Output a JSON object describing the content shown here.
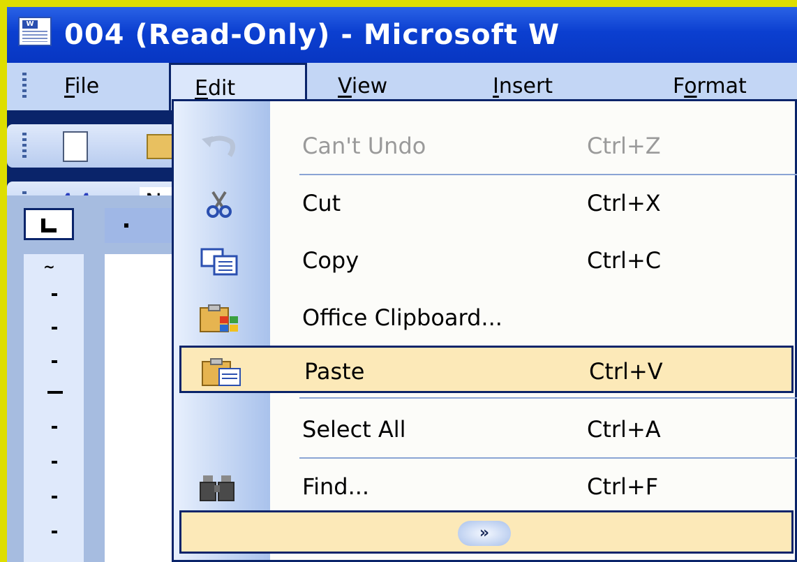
{
  "window": {
    "title": "004 (Read-Only) - Microsoft W"
  },
  "menubar": {
    "items": [
      {
        "label": "File",
        "accel": "F"
      },
      {
        "label": "Edit",
        "accel": "E",
        "active": true
      },
      {
        "label": "View",
        "accel": "V"
      },
      {
        "label": "Insert",
        "accel": "I"
      },
      {
        "label": "Format",
        "accel": "o"
      }
    ]
  },
  "format_toolbar": {
    "font_partial": "N"
  },
  "edit_menu": {
    "items": [
      {
        "label": "Can't Undo",
        "shortcut": "Ctrl+Z",
        "icon": "undo-icon",
        "enabled": false
      },
      {
        "label": "Cut",
        "shortcut": "Ctrl+X",
        "icon": "scissors-icon",
        "enabled": true
      },
      {
        "label": "Copy",
        "shortcut": "Ctrl+C",
        "icon": "copy-icon",
        "enabled": true
      },
      {
        "label": "Office Clipboard...",
        "shortcut": "",
        "icon": "clipboard-icon",
        "enabled": true
      },
      {
        "label": "Paste",
        "shortcut": "Ctrl+V",
        "icon": "paste-icon",
        "enabled": true,
        "highlighted": true
      },
      {
        "label": "Select All",
        "shortcut": "Ctrl+A",
        "icon": "",
        "enabled": true
      },
      {
        "label": "Find...",
        "shortcut": "Ctrl+F",
        "icon": "binoculars-icon",
        "enabled": true
      }
    ],
    "expand_glyph": "»"
  },
  "colors": {
    "titlebar": "#0b3fd0",
    "menubar": "#c3d6f5",
    "highlight": "#fce9b8",
    "border": "#0a246a",
    "background": "#dede00"
  }
}
